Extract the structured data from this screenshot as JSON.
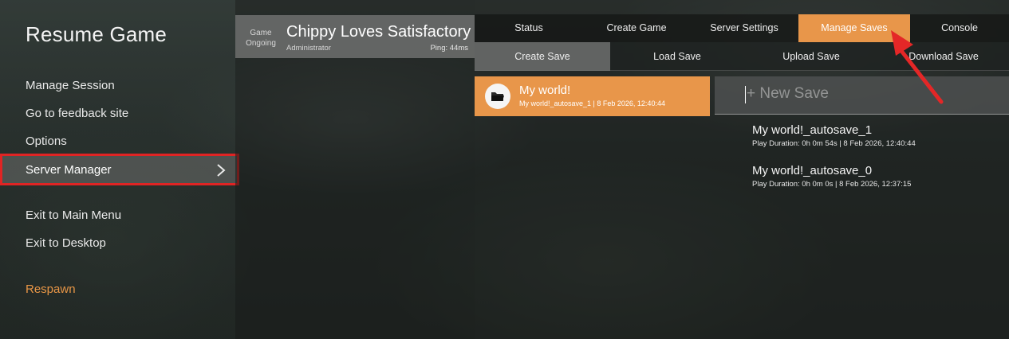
{
  "left_menu": {
    "title": "Resume Game",
    "items": [
      {
        "label": "Manage Session"
      },
      {
        "label": "Go to feedback site"
      },
      {
        "label": "Options"
      },
      {
        "label": "Server Manager",
        "selected": true
      },
      {
        "label": "Exit to Main Menu"
      },
      {
        "label": "Exit to Desktop"
      }
    ],
    "respawn": "Respawn"
  },
  "session": {
    "state": "Game Ongoing",
    "name": "Chippy Loves Satisfactory",
    "role": "Administrator",
    "ping": "Ping: 44ms"
  },
  "tabs": [
    "Status",
    "Create Game",
    "Server Settings",
    "Manage Saves",
    "Console"
  ],
  "active_tab": "Manage Saves",
  "subtabs": [
    "Create Save",
    "Load Save",
    "Upload Save",
    "Download Save"
  ],
  "active_subtab": "Create Save",
  "sessions_list": [
    {
      "name": "My world!",
      "detail": "My world!_autosave_1 | 8 Feb 2026, 12:40:44",
      "icon": "folder-icon"
    }
  ],
  "new_save_placeholder": "+ New Save",
  "saves": [
    {
      "name": "My world!_autosave_1",
      "detail": "Play Duration: 0h 0m 54s | 8 Feb 2026, 12:40:44"
    },
    {
      "name": "My world!_autosave_0",
      "detail": "Play Duration: 0h 0m 0s | 8 Feb 2026, 12:37:15"
    }
  ],
  "colors": {
    "accent": "#e8964a",
    "highlight_border": "#e02424",
    "respawn": "#e89646",
    "arrow": "#e42727"
  }
}
